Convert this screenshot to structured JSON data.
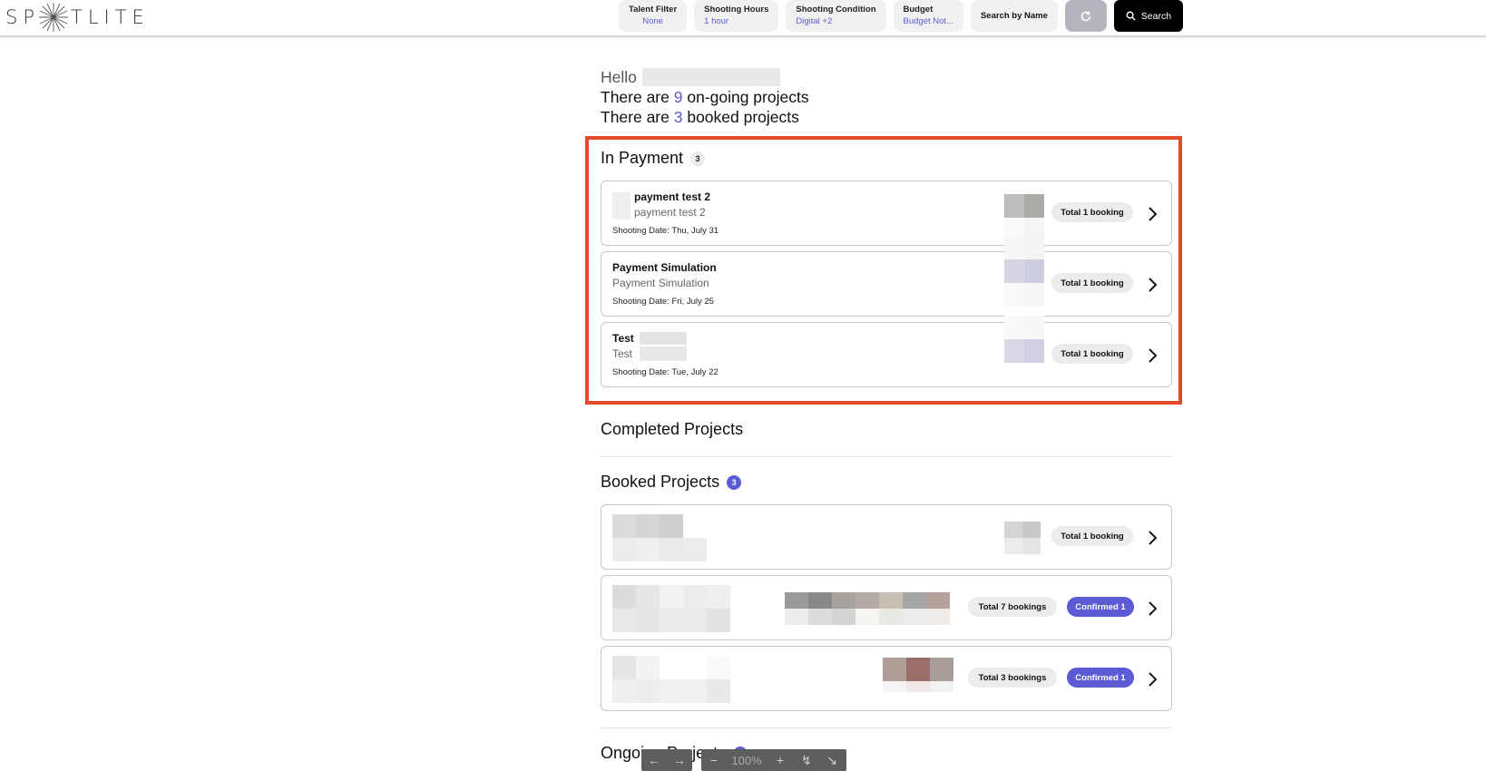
{
  "header": {
    "logo_left": "SP",
    "logo_right": "TLITE",
    "filters": [
      {
        "label": "Talent Filter",
        "value": "None"
      },
      {
        "label": "Shooting Hours",
        "value": "1 hour"
      },
      {
        "label": "Shooting Condition",
        "value": "Digital +2"
      },
      {
        "label": "Budget",
        "value": "Budget Not..."
      }
    ],
    "search_by_name": "Search by Name",
    "search_label": "Search"
  },
  "greeting": {
    "hello": "Hello",
    "line1_pre": "There are ",
    "ongoing_count": "9",
    "line1_post": " on-going projects",
    "line2_pre": "There are ",
    "booked_count": "3",
    "line2_post": " booked projects"
  },
  "in_payment": {
    "title": "In Payment",
    "count": "3",
    "cards": [
      {
        "title": "payment test 2",
        "subtitle": "payment test 2",
        "date": "Shooting Date: Thu, July 31",
        "bookings": "Total 1 booking"
      },
      {
        "title": "Payment Simulation",
        "subtitle": "Payment Simulation",
        "date": "Shooting Date: Fri, July 25",
        "bookings": "Total 1 booking"
      },
      {
        "title": "Test",
        "subtitle": "Test",
        "date": "Shooting Date: Tue, July 22",
        "bookings": "Total 1 booking"
      }
    ]
  },
  "completed": {
    "title": "Completed Projects"
  },
  "booked": {
    "title": "Booked Projects",
    "count": "3",
    "cards": [
      {
        "bookings": "Total 1 booking"
      },
      {
        "bookings": "Total 7 bookings",
        "confirmed": "Confirmed 1"
      },
      {
        "bookings": "Total 3 bookings",
        "confirmed": "Confirmed 1"
      }
    ]
  },
  "ongoing": {
    "title": "Ongoing Projects"
  },
  "viewer": {
    "zoom": "100%"
  },
  "colors": {
    "accent": "#5b5bd6",
    "highlight": "#e24a2b"
  }
}
